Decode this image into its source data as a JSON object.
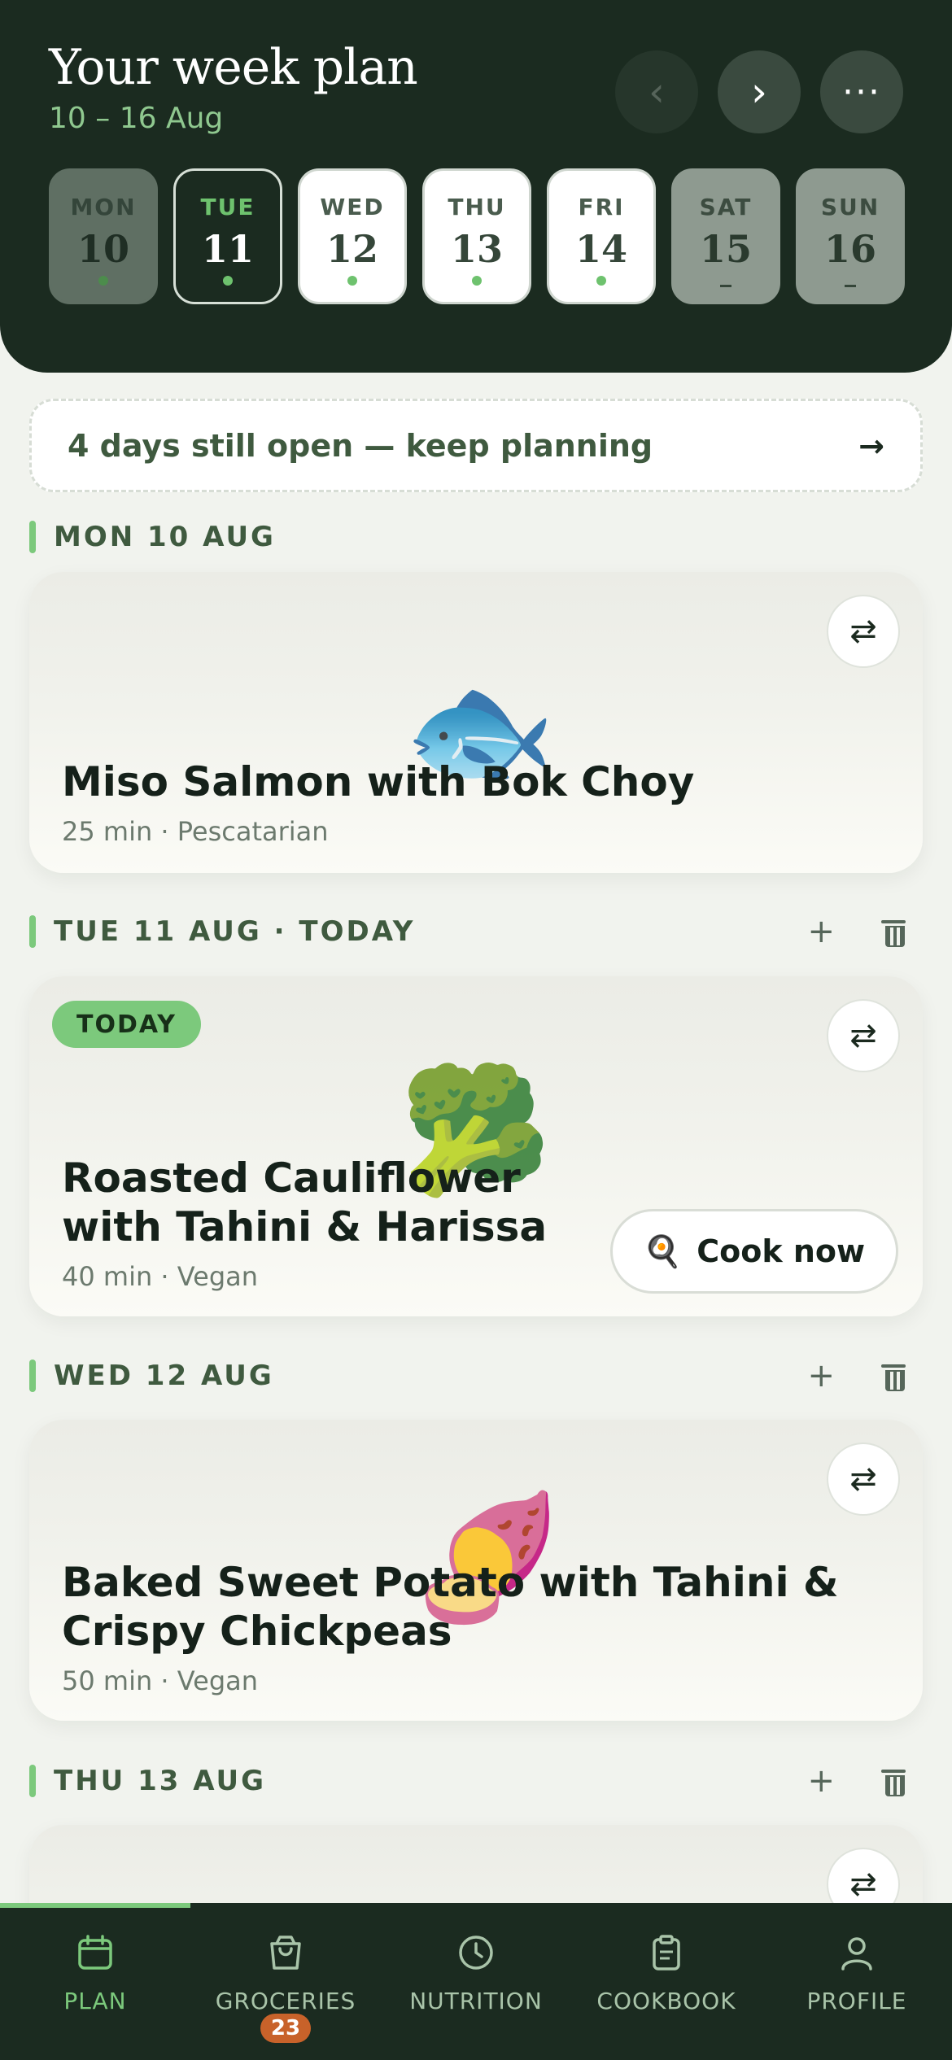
{
  "header": {
    "title": "Your week plan",
    "date_range": "10 – 16 Aug",
    "prev_icon": "‹",
    "next_icon": "›",
    "more_icon": "···"
  },
  "days": [
    {
      "name": "MON",
      "num": "10",
      "state": "past",
      "marker": "dot"
    },
    {
      "name": "TUE",
      "num": "11",
      "state": "today",
      "marker": "dot"
    },
    {
      "name": "WED",
      "num": "12",
      "state": "planned",
      "marker": "dot"
    },
    {
      "name": "THU",
      "num": "13",
      "state": "planned",
      "marker": "dot"
    },
    {
      "name": "FRI",
      "num": "14",
      "state": "planned",
      "marker": "dot"
    },
    {
      "name": "SAT",
      "num": "15",
      "state": "open",
      "marker": "–"
    },
    {
      "name": "SUN",
      "num": "16",
      "state": "open",
      "marker": "–"
    }
  ],
  "banner": {
    "text": "4 days still open — keep planning",
    "arrow": "→"
  },
  "sections": [
    {
      "label": "MON 10 AUG"
    },
    {
      "label": "TUE 11 AUG · TODAY",
      "add": "+"
    },
    {
      "label": "WED 12 AUG",
      "add": "+"
    },
    {
      "label": "THU 13 AUG",
      "add": "+"
    }
  ],
  "meals": [
    {
      "name": "Miso Salmon with Bok Choy",
      "meta": "25 min · Pescatarian",
      "icon": "🐟"
    },
    {
      "name_line1": "Roasted Cauliflower",
      "name_line2": "with Tahini & Harissa",
      "meta": "40 min · Vegan",
      "icon": "🥦",
      "tag": "TODAY",
      "cook_label": "Cook now",
      "cook_icon": "🍳"
    },
    {
      "name_line1": "Baked Sweet Potato with Tahini &",
      "name_line2": "Crispy Chickpeas",
      "meta": "50 min · Vegan",
      "icon": "🍠"
    }
  ],
  "swap_icon": "⇄",
  "nav": {
    "tabs": [
      {
        "label": "PLAN",
        "active": true
      },
      {
        "label": "GROCERIES",
        "badge": "23"
      },
      {
        "label": "NUTRITION"
      },
      {
        "label": "COOKBOOK"
      },
      {
        "label": "PROFILE"
      }
    ]
  },
  "colors": {
    "accent": "#7cc97c",
    "header_bg": "#1b2b20",
    "badge": "#c8622a"
  }
}
